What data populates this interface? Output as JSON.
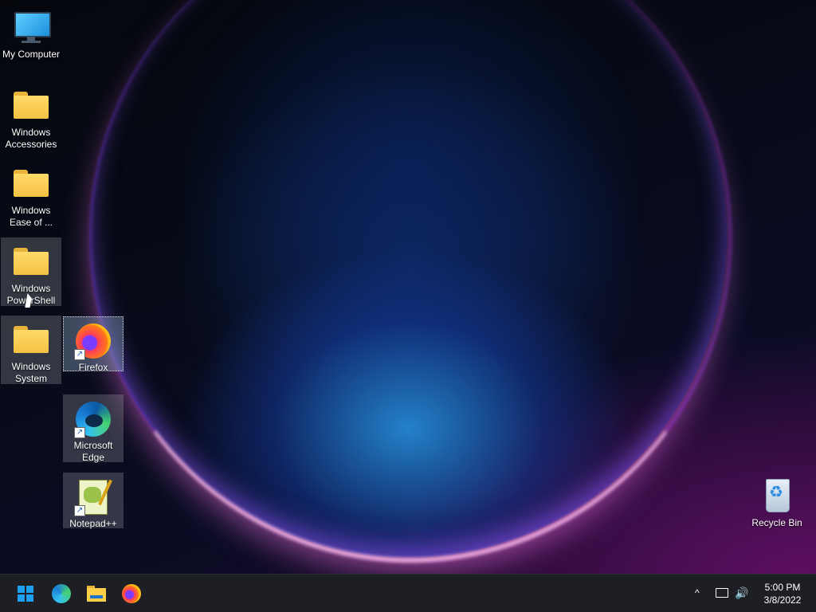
{
  "desktop": {
    "icons": [
      {
        "label": "My Computer"
      },
      {
        "label": "Windows Accessories"
      },
      {
        "label": "Windows Ease of ..."
      },
      {
        "label": "Windows PowerShell"
      },
      {
        "label": "Windows System"
      },
      {
        "label": "Firefox"
      },
      {
        "label": "Microsoft Edge"
      },
      {
        "label": "Notepad++"
      },
      {
        "label": "Recycle Bin"
      }
    ]
  },
  "taskbar": {
    "pinned": [
      {
        "icon": "windows-start-icon"
      },
      {
        "icon": "edge-icon"
      },
      {
        "icon": "file-explorer-icon"
      },
      {
        "icon": "firefox-icon"
      }
    ],
    "tray": {
      "chevron": "^",
      "volume": "🔊"
    },
    "clock": {
      "time": "5:00 PM",
      "date": "3/8/2022"
    }
  },
  "colors": {
    "taskbar_bg": "#1d1f24",
    "accent": "#1ea0f0",
    "folder": "#ffd969"
  }
}
